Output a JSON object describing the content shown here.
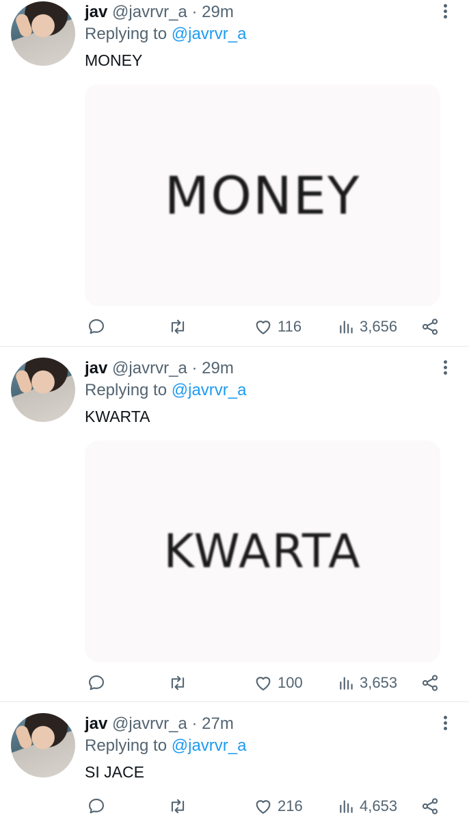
{
  "tweets": [
    {
      "name": "jav",
      "handle": "@javrvr_a",
      "dot": "·",
      "time": "29m",
      "reply_prefix": "Replying to",
      "reply_mention": "@javrvr_a",
      "text": "MONEY",
      "media_text": "MONEY",
      "likes": "116",
      "views": "3,656"
    },
    {
      "name": "jav",
      "handle": "@javrvr_a",
      "dot": "·",
      "time": "29m",
      "reply_prefix": "Replying to",
      "reply_mention": "@javrvr_a",
      "text": "KWARTA",
      "media_text": "KWARTA",
      "likes": "100",
      "views": "3,653"
    },
    {
      "name": "jav",
      "handle": "@javrvr_a",
      "dot": "·",
      "time": "27m",
      "reply_prefix": "Replying to",
      "reply_mention": "@javrvr_a",
      "text": "SI JACE",
      "likes": "216",
      "views": "4,653"
    }
  ],
  "icons": {
    "reply": "reply-icon",
    "retweet": "retweet-icon",
    "like": "heart-icon",
    "views": "views-icon",
    "share": "share-icon",
    "more": "more-vertical-icon"
  },
  "colors": {
    "link": "#1d9bf0",
    "secondary": "#536471",
    "text": "#0f1419"
  }
}
